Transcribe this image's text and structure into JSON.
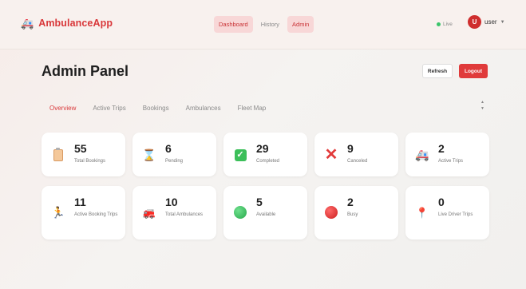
{
  "navbar": {
    "brand_icon": "ambulance-icon",
    "brand": "AmbulanceApp",
    "tabs": [
      {
        "label": "Dashboard",
        "active": true
      },
      {
        "label": "History",
        "active": false
      },
      {
        "label": "Admin",
        "active": true
      }
    ],
    "status": "Live",
    "avatar_initial": "U",
    "user": "user",
    "caret": "▼"
  },
  "header": {
    "title": "Admin Panel",
    "refresh_label": "Refresh",
    "logout_label": "Logout"
  },
  "subtabs": [
    {
      "label": "Overview",
      "active": true
    },
    {
      "label": "Active Trips",
      "active": false
    },
    {
      "label": "Bookings",
      "active": false
    },
    {
      "label": "Ambulances",
      "active": false
    },
    {
      "label": "Fleet Map",
      "active": false
    }
  ],
  "stats": [
    {
      "value": "55",
      "label": "Total Bookings",
      "icon": "clipboard-icon"
    },
    {
      "value": "6",
      "label": "Pending",
      "icon": "hourglass-icon"
    },
    {
      "value": "29",
      "label": "Completed",
      "icon": "check-icon"
    },
    {
      "value": "9",
      "label": "Canceled",
      "icon": "x-icon"
    },
    {
      "value": "2",
      "label": "Active Trips",
      "icon": "ambulance-icon"
    },
    {
      "value": "11",
      "label": "Active Booking Trips",
      "icon": "runner-icon"
    },
    {
      "value": "10",
      "label": "Total Ambulances",
      "icon": "fire-truck-icon"
    },
    {
      "value": "5",
      "label": "Available",
      "icon": "green-circle-icon"
    },
    {
      "value": "2",
      "label": "Busy",
      "icon": "red-circle-icon"
    },
    {
      "value": "0",
      "label": "Live Driver Trips",
      "icon": "pin-icon"
    }
  ],
  "colors": {
    "brand": "#d9383a",
    "logout": "#e03b3b",
    "live": "#3ac46a"
  }
}
